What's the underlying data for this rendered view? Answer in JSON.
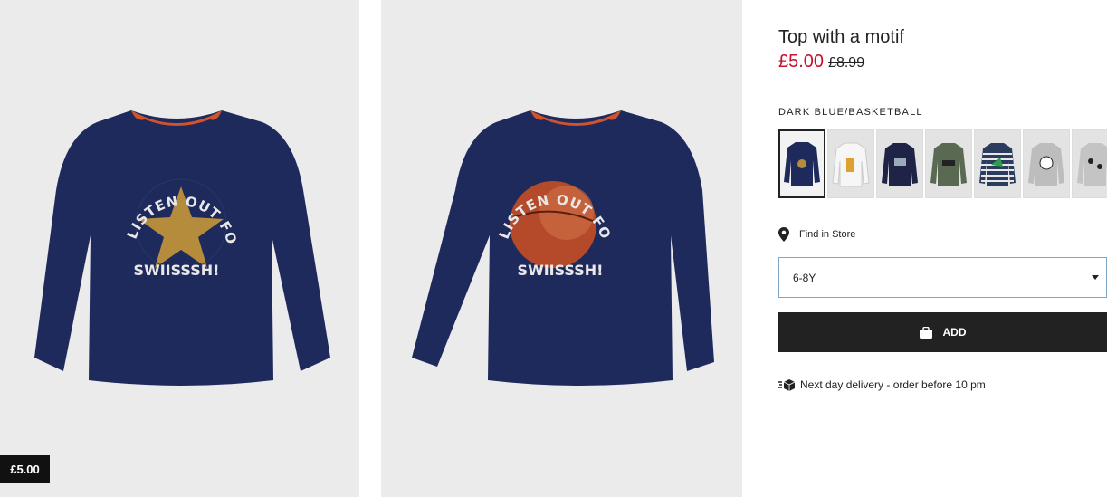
{
  "product": {
    "title": "Top with a motif",
    "sale_price": "£5.00",
    "old_price": "£8.99",
    "color_label": "DARK BLUE/BASKETBALL",
    "badge_price": "£5.00"
  },
  "images": {
    "front_text_top": "LISTEN OUT FOR THE",
    "front_text_bottom": "SWIISSSH!"
  },
  "swatches": [
    {
      "name": "dark-blue-star",
      "shirt": "#1e2a5c"
    },
    {
      "name": "white",
      "shirt": "#f4f4f4"
    },
    {
      "name": "navy-car",
      "shirt": "#1f2446"
    },
    {
      "name": "khaki",
      "shirt": "#5a6a52"
    },
    {
      "name": "striped-dino",
      "shirt": "#2c3c5e"
    },
    {
      "name": "grey-football",
      "shirt": "#bdbdbd"
    },
    {
      "name": "grey-spider",
      "shirt": "#c4c4c4"
    }
  ],
  "store": {
    "label": "Find in Store"
  },
  "size_select": {
    "value": "6-8Y"
  },
  "add_button": {
    "label": "ADD"
  },
  "delivery": {
    "text": "Next day delivery - order before 10 pm"
  },
  "colors": {
    "sale": "#c8102e",
    "button": "#222222",
    "shirt": "#1e2a5c"
  }
}
